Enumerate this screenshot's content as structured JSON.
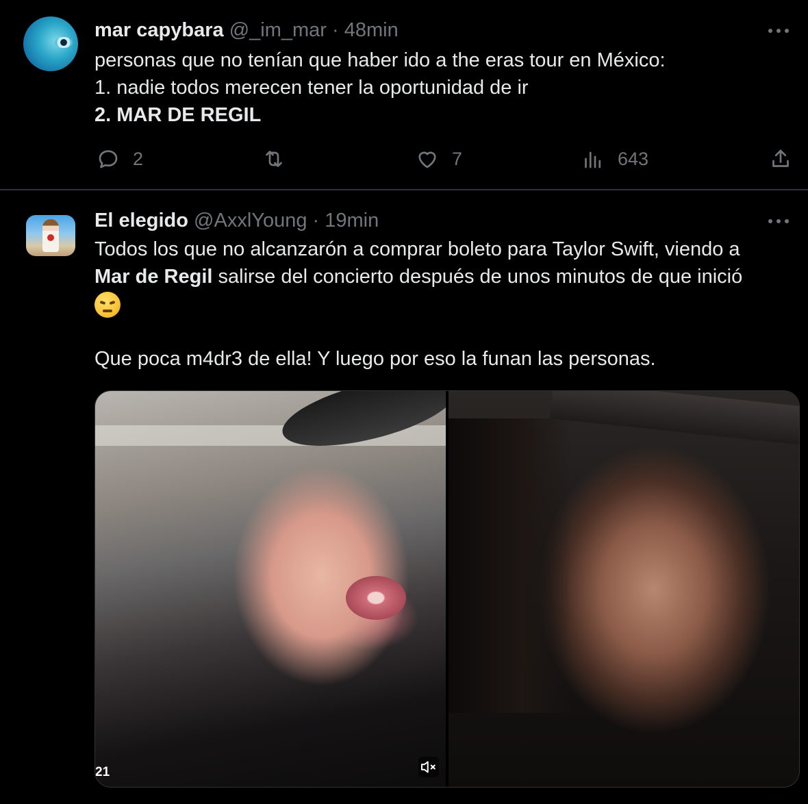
{
  "tweets": [
    {
      "display_name": "mar capybara",
      "handle": "@_im_mar",
      "separator": "·",
      "time": "48min",
      "lines": [
        "personas que no tenían que haber ido a the eras tour en México:",
        "1. nadie todos merecen tener la oportunidad de ir",
        "2. MAR DE REGIL"
      ],
      "stats": {
        "replies": "2",
        "retweets": "",
        "likes": "7",
        "views": "643"
      }
    },
    {
      "display_name": "El elegido",
      "handle": "@AxxlYoung",
      "separator": "·",
      "time": "19min",
      "line1": "Todos los que no alcanzarón a comprar boleto para Taylor Swift, viendo a",
      "line2_bold": "Mar de Regil",
      "line2_rest": " salirse del concierto después de unos minutos de que inició",
      "line4": "Que poca m4dr3 de ella! Y luego por eso la funan las personas.",
      "media": {
        "video_timestamp": "21"
      }
    }
  ],
  "icons": {
    "more": "more-horizontal-icon",
    "reply": "reply-icon",
    "retweet": "retweet-icon",
    "like": "heart-icon",
    "views": "views-icon",
    "share": "share-icon",
    "emoji": "angry-face-emoji",
    "mute": "volume-mute-icon"
  },
  "colors": {
    "background": "#000000",
    "text": "#e7e9ea",
    "muted": "#71767b",
    "divider": "#2f3336"
  }
}
